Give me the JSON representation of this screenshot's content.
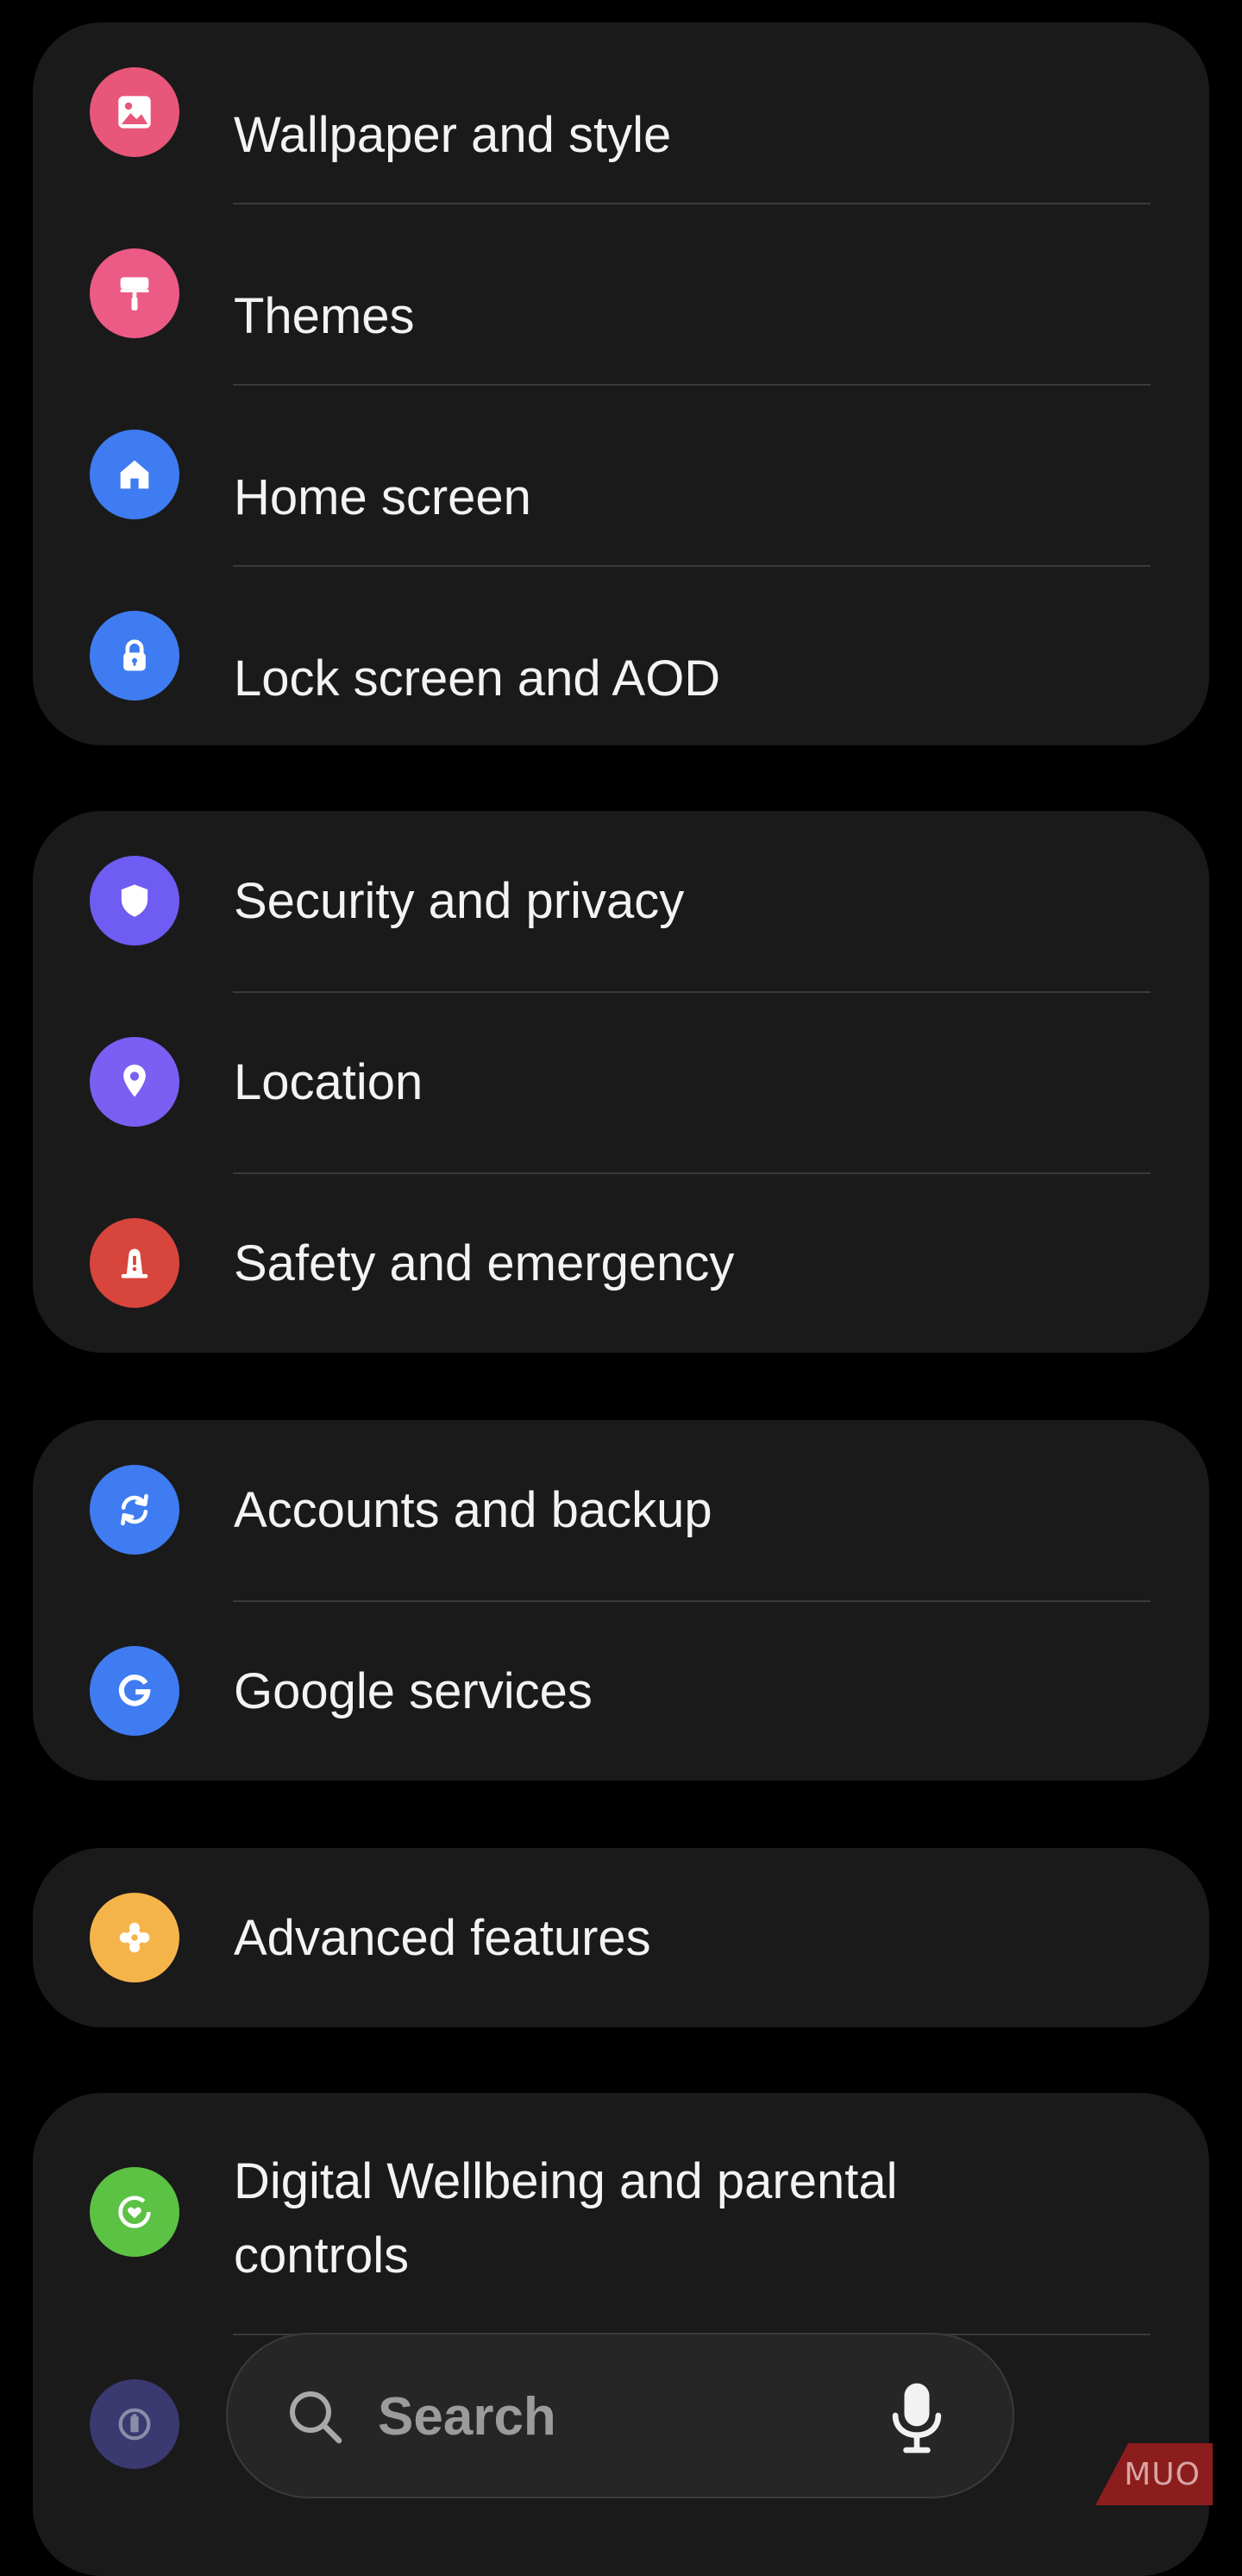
{
  "groups": [
    {
      "items": [
        {
          "label": "Wallpaper and style",
          "icon": "image-icon",
          "color": "#e8567a"
        },
        {
          "label": "Themes",
          "icon": "paintbrush-icon",
          "color": "#ec5a86"
        },
        {
          "label": "Home screen",
          "icon": "home-icon",
          "color": "#3f7cf1"
        },
        {
          "label": "Lock screen and AOD",
          "icon": "lock-icon",
          "color": "#3f7cf1"
        }
      ]
    },
    {
      "items": [
        {
          "label": "Security and privacy",
          "icon": "shield-icon",
          "color": "#6f5cf2"
        },
        {
          "label": "Location",
          "icon": "location-pin-icon",
          "color": "#7b5ff3"
        },
        {
          "label": "Safety and emergency",
          "icon": "emergency-siren-icon",
          "color": "#d8453c"
        }
      ]
    },
    {
      "items": [
        {
          "label": "Accounts and backup",
          "icon": "sync-icon",
          "color": "#3f7cf1"
        },
        {
          "label": "Google services",
          "icon": "google-g-icon",
          "color": "#3f7cf1"
        }
      ]
    },
    {
      "items": [
        {
          "label": "Advanced features",
          "icon": "gear-puzzle-icon",
          "color": "#f5b44a"
        }
      ]
    },
    {
      "items": [
        {
          "label": "Digital Wellbeing and parental controls",
          "icon": "heart-ring-icon",
          "color": "#5cc244"
        },
        {
          "label": "",
          "icon": "battery-care-icon",
          "color": "#3a3970"
        }
      ]
    }
  ],
  "search": {
    "placeholder": "Search",
    "search_icon": "search-icon",
    "mic_icon": "mic-icon"
  },
  "watermark": {
    "text": "MUO"
  }
}
